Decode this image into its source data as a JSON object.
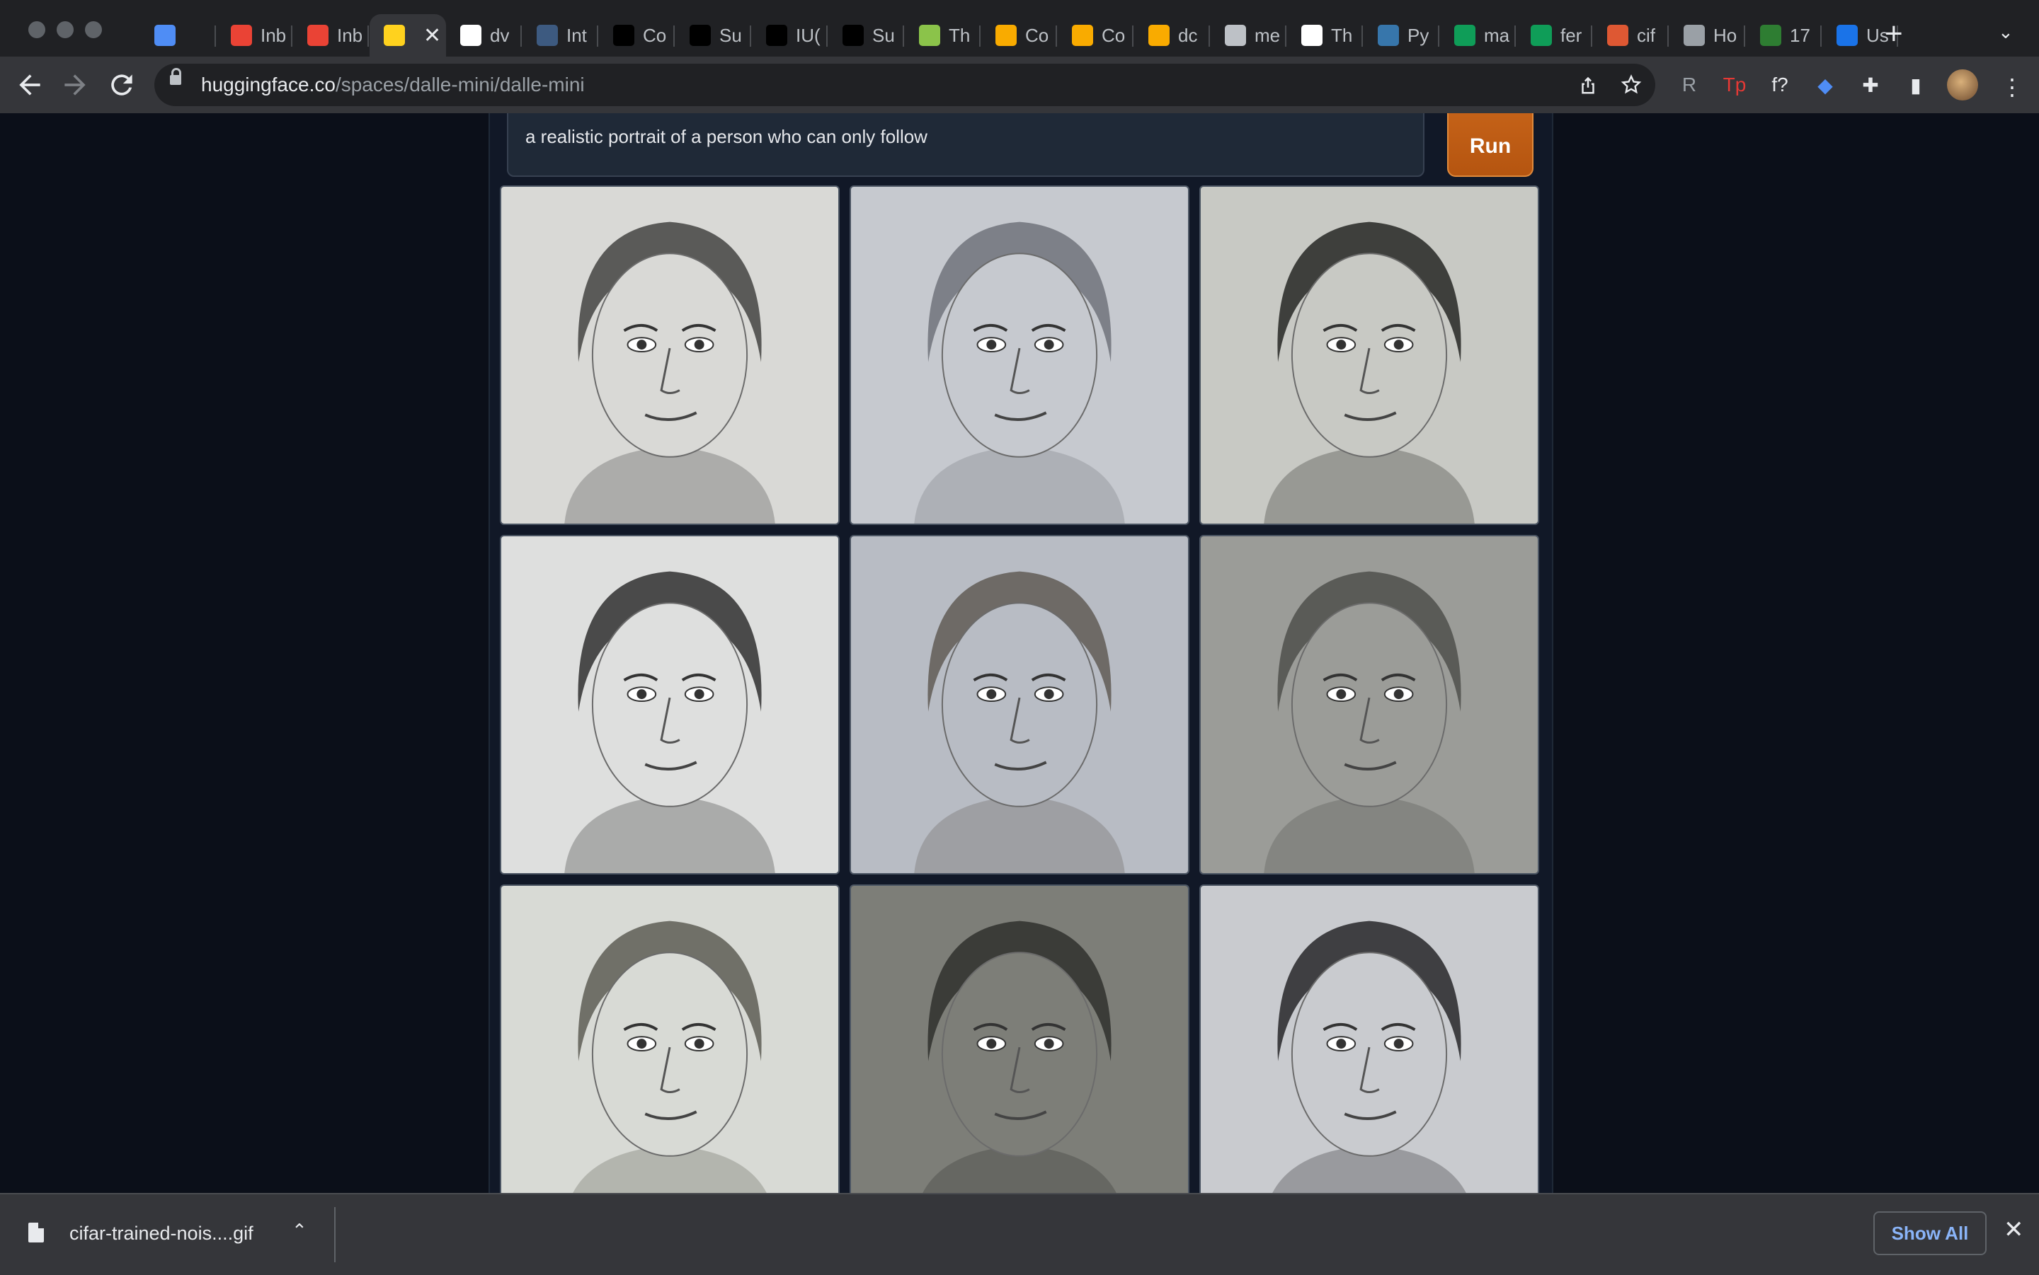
{
  "browser": {
    "tabs": [
      {
        "label": "",
        "icon": "gem-icon",
        "color": "#4f8df5"
      },
      {
        "label": "Inb",
        "icon": "gmail-icon",
        "color": "#ea4335"
      },
      {
        "label": "Inb",
        "icon": "gmail-icon",
        "color": "#ea4335"
      },
      {
        "label": "",
        "icon": "hugging-face-icon",
        "color": "#ffd21e",
        "active": true
      },
      {
        "label": "dv",
        "icon": "github-icon",
        "color": "#ffffff"
      },
      {
        "label": "Int",
        "icon": "tds-icon",
        "color": "#3d5a80"
      },
      {
        "label": "Co",
        "icon": "black-square-icon",
        "color": "#000000"
      },
      {
        "label": "Su",
        "icon": "black-square-icon",
        "color": "#000000"
      },
      {
        "label": "IU(",
        "icon": "black-square-icon",
        "color": "#000000"
      },
      {
        "label": "Su",
        "icon": "black-square-icon",
        "color": "#000000"
      },
      {
        "label": "Th",
        "icon": "smiley-icon",
        "color": "#8bc34a"
      },
      {
        "label": "Co",
        "icon": "colab-icon",
        "color": "#f9ab00"
      },
      {
        "label": "Co",
        "icon": "colab-icon",
        "color": "#f9ab00"
      },
      {
        "label": "dc",
        "icon": "colab-icon",
        "color": "#f9ab00"
      },
      {
        "label": "me",
        "icon": "infinity-icon",
        "color": "#bdc1c6"
      },
      {
        "label": "Th",
        "icon": "qr-icon",
        "color": "#ffffff"
      },
      {
        "label": "Py",
        "icon": "python-icon",
        "color": "#3776ab"
      },
      {
        "label": "ma",
        "icon": "drive-icon",
        "color": "#0f9d58"
      },
      {
        "label": "fer",
        "icon": "drive-icon",
        "color": "#0f9d58"
      },
      {
        "label": "cif",
        "icon": "duckduckgo-icon",
        "color": "#de5833"
      },
      {
        "label": "Ho",
        "icon": "document-icon",
        "color": "#9aa0a6"
      },
      {
        "label": "17",
        "icon": "hp-icon",
        "color": "#2e7d32"
      },
      {
        "label": "Us",
        "icon": "star-person-icon",
        "color": "#1a73e8"
      }
    ],
    "close_tab": "✕",
    "new_tab": "+",
    "tab_search": "⌄",
    "url_host": "huggingface.co",
    "url_path": "/spaces/dalle-mini/dalle-mini",
    "extensions": [
      {
        "name": "readwise-icon",
        "glyph": "R",
        "color": "#9aa0a6"
      },
      {
        "name": "tp-icon",
        "glyph": "Tp",
        "color": "#e53935"
      },
      {
        "name": "function-icon",
        "glyph": "f?",
        "color": "#e8eaed"
      },
      {
        "name": "gem-icon",
        "glyph": "◆",
        "color": "#4f8df5"
      },
      {
        "name": "puzzle-icon",
        "glyph": "✚",
        "color": "#e8eaed"
      },
      {
        "name": "sidebar-icon",
        "glyph": "▮",
        "color": "#e8eaed"
      }
    ]
  },
  "app": {
    "prompt": "a realistic portrait of a person who can only follow",
    "run_label": "Run",
    "images": [
      {
        "name": "portrait-1",
        "tone": "#d9d9d6",
        "hair": "#5a5a58"
      },
      {
        "name": "portrait-2",
        "tone": "#c6c9cf",
        "hair": "#7d8088"
      },
      {
        "name": "portrait-3",
        "tone": "#c8c9c4",
        "hair": "#3e3f3c"
      },
      {
        "name": "portrait-4",
        "tone": "#dedfde",
        "hair": "#4a4a4a"
      },
      {
        "name": "portrait-5",
        "tone": "#b8bcc4",
        "hair": "#6e6a66"
      },
      {
        "name": "portrait-6",
        "tone": "#9b9c98",
        "hair": "#5a5b57"
      },
      {
        "name": "portrait-7",
        "tone": "#d8dad5",
        "hair": "#707068"
      },
      {
        "name": "portrait-8",
        "tone": "#7d7e78",
        "hair": "#3b3c38"
      },
      {
        "name": "portrait-9",
        "tone": "#c9cbcf",
        "hair": "#3f3f42"
      }
    ]
  },
  "download": {
    "filename": "cifar-trained-nois....gif",
    "chevron": "⌃",
    "show_all": "Show All",
    "close": "✕"
  }
}
